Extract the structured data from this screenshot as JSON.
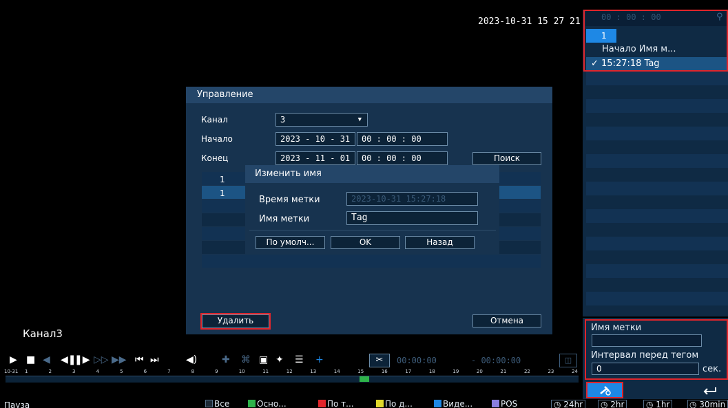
{
  "video": {
    "timestamp": "2023-10-31 15 27 21",
    "channel_label": "Канал3"
  },
  "right_panel": {
    "time_display": "00 : 00 : 00",
    "selected_channel": "1",
    "header": "Начало  Имя м...",
    "tag_row": "✓ 15:27:18   Tag",
    "tag_name_label": "Имя метки",
    "tag_name_value": "",
    "interval_label": "Интервал перед тегом",
    "interval_value": "0",
    "interval_unit": "сек."
  },
  "dialog": {
    "title": "Управление",
    "channel_label": "Канал",
    "channel_value": "3",
    "start_label": "Начало",
    "start_date": "2023 - 10 - 31",
    "start_time": "00 : 00 : 00",
    "end_label": "Конец",
    "end_date": "2023 - 11 - 01",
    "end_time": "00 : 00 : 00",
    "search_button": "Поиск",
    "list_col1_row1": "1",
    "list_col1_row2": "1",
    "delete_button": "Удалить",
    "cancel_button": "Отмена"
  },
  "rename_dialog": {
    "title": "Изменить имя",
    "tag_time_label": "Время метки",
    "tag_time_value": "2023-10-31 15:27:18",
    "tag_name_label": "Имя метки",
    "tag_name_value": "Tag",
    "default_button": "По умолч...",
    "ok_button": "OK",
    "back_button": "Назад"
  },
  "playback": {
    "start_time": "00:00:00",
    "end_time": "- 00:00:00",
    "date_short": "10-31",
    "hour_ticks": [
      "1",
      "2",
      "3",
      "4",
      "5",
      "6",
      "7",
      "8",
      "9",
      "10",
      "11",
      "12",
      "13",
      "14",
      "15",
      "16",
      "17",
      "18",
      "19",
      "20",
      "21",
      "22",
      "23",
      "24"
    ]
  },
  "status": {
    "state": "Пауза",
    "filters": [
      "Все",
      "Осно...",
      "По т...",
      "По д...",
      "Виде...",
      "POS"
    ],
    "zoom_options": [
      "24hr",
      "2hr",
      "1hr",
      "30min"
    ]
  },
  "colors": {
    "panel": "#0f2a44",
    "dialog": "#17334f",
    "accent": "#1e88e5",
    "highlight_box": "#e0252b"
  }
}
